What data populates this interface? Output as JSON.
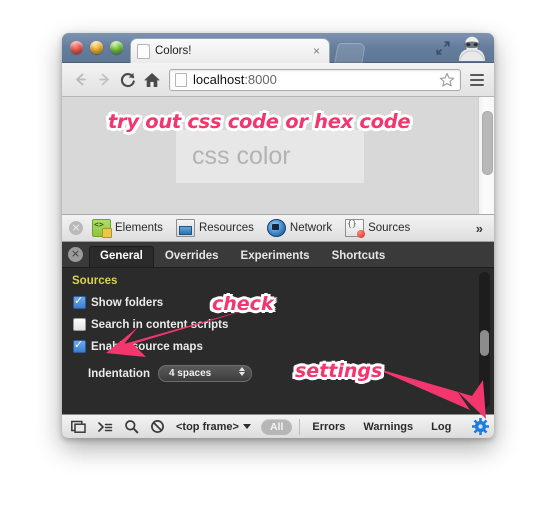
{
  "browser": {
    "window_controls": [
      {
        "name": "close",
        "color": "#ee5f52"
      },
      {
        "name": "minimize",
        "color": "#f2b431"
      },
      {
        "name": "zoom",
        "color": "#76c73f"
      }
    ],
    "tab": {
      "title": "Colors!",
      "close_label": "×",
      "favicon": "page-icon"
    },
    "new_tab_label": "",
    "toolbar": {
      "back": "←",
      "forward": "→",
      "reload": "↻",
      "home": "home-icon",
      "menu": "hamburger-icon",
      "expand": "expand-icon",
      "profile": "incognito-icon"
    },
    "omnibox": {
      "host": "localhost",
      "port": ":8000",
      "bookmark": "star-icon"
    }
  },
  "page": {
    "input_placeholder": "css color"
  },
  "devtools": {
    "close_label": "×",
    "panels": [
      {
        "label": "Elements",
        "icon": "elements-icon"
      },
      {
        "label": "Resources",
        "icon": "resources-icon"
      },
      {
        "label": "Network",
        "icon": "network-icon"
      },
      {
        "label": "Sources",
        "icon": "sources-icon"
      }
    ],
    "overflow_label": "»",
    "settings_close_label": "×",
    "settings_tabs": [
      {
        "label": "General",
        "active": true
      },
      {
        "label": "Overrides",
        "active": false
      },
      {
        "label": "Experiments",
        "active": false
      },
      {
        "label": "Shortcuts",
        "active": false
      }
    ],
    "general": {
      "section_title": "Sources",
      "checkboxes": [
        {
          "label": "Show folders",
          "checked": true
        },
        {
          "label": "Search in content scripts",
          "checked": false
        },
        {
          "label": "Enable source maps",
          "checked": true
        }
      ],
      "indentation": {
        "label": "Indentation",
        "value": "4 spaces"
      }
    },
    "statusbar": {
      "dock_icon": "dock-icon",
      "console_icon": "console-prompt-icon",
      "search_icon": "search-icon",
      "clear_icon": "clear-console-icon",
      "frame_selector": "<top frame>",
      "filter_all": "All",
      "filters": [
        "Errors",
        "Warnings",
        "Log"
      ],
      "settings_icon": "gear-icon"
    }
  },
  "annotations": [
    {
      "id": "top",
      "text": "try out css code or hex code",
      "color": "#f4366e"
    },
    {
      "id": "check",
      "text": "check",
      "color": "#f4366e"
    },
    {
      "id": "settings",
      "text": "settings",
      "color": "#f4366e"
    }
  ]
}
